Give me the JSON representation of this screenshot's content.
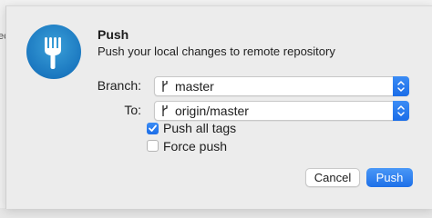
{
  "dialog": {
    "title": "Push",
    "subtitle": "Push your local changes to remote repository",
    "icon": "fork-icon"
  },
  "branch": {
    "label": "Branch:",
    "value": "master",
    "icon": "branch-icon"
  },
  "to": {
    "label": "To:",
    "value": "origin/master",
    "icon": "branch-icon"
  },
  "options": {
    "push_all_tags": {
      "label": "Push all tags",
      "checked": true
    },
    "force_push": {
      "label": "Force push",
      "checked": false
    }
  },
  "buttons": {
    "cancel": "Cancel",
    "push": "Push"
  },
  "background": {
    "edge_text": "ec"
  },
  "colors": {
    "accent": "#1b6de8",
    "icon_blue": "#1b78c0"
  }
}
